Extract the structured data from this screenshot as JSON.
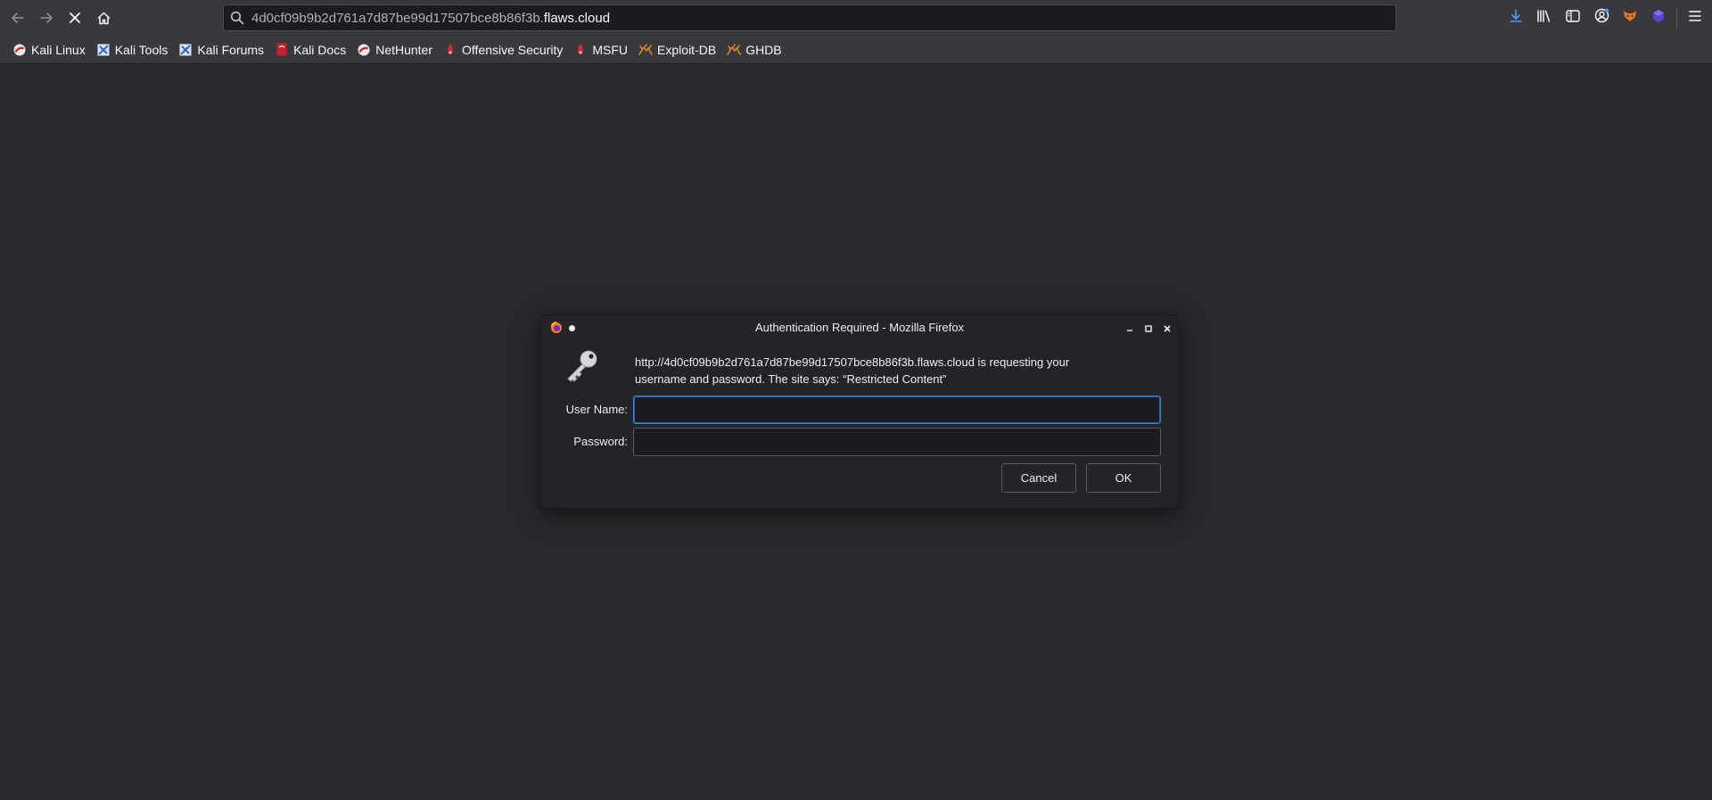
{
  "toolbar": {
    "back_icon": "arrow-left-icon",
    "forward_icon": "arrow-right-icon",
    "stop_icon": "stop-icon",
    "home_icon": "home-icon",
    "url_prefix": "4d0cf09b9b2d761a7d87be99d17507bce8b86f3b.",
    "url_host": "flaws.cloud",
    "right_icons": [
      "download-icon",
      "library-icon",
      "sidebar-icon",
      "account-icon",
      "extension-fox-icon",
      "extension-cube-icon",
      "menu-icon"
    ]
  },
  "bookmarks": [
    {
      "label": "Kali Linux",
      "icon": "kali-icon"
    },
    {
      "label": "Kali Tools",
      "icon": "kali-tools-icon"
    },
    {
      "label": "Kali Forums",
      "icon": "kali-forums-icon"
    },
    {
      "label": "Kali Docs",
      "icon": "kali-docs-icon"
    },
    {
      "label": "NetHunter",
      "icon": "nethunter-icon"
    },
    {
      "label": "Offensive Security",
      "icon": "offsec-icon"
    },
    {
      "label": "MSFU",
      "icon": "msfu-icon"
    },
    {
      "label": "Exploit-DB",
      "icon": "exploitdb-icon"
    },
    {
      "label": "GHDB",
      "icon": "ghdb-icon"
    }
  ],
  "dialog": {
    "title": "Authentication Required - Mozilla Firefox",
    "message_line1": "http://4d0cf09b9b2d761a7d87be99d17507bce8b86f3b.flaws.cloud is requesting your",
    "message_line2": "username and password. The site says: “Restricted Content”",
    "username_label": "User Name:",
    "password_label": "Password:",
    "username_value": "",
    "password_value": "",
    "cancel_label": "Cancel",
    "ok_label": "OK"
  },
  "colors": {
    "toolbar_bg": "#38383d",
    "content_bg": "#2a2a2e",
    "focus_accent": "#3b7fd8"
  }
}
